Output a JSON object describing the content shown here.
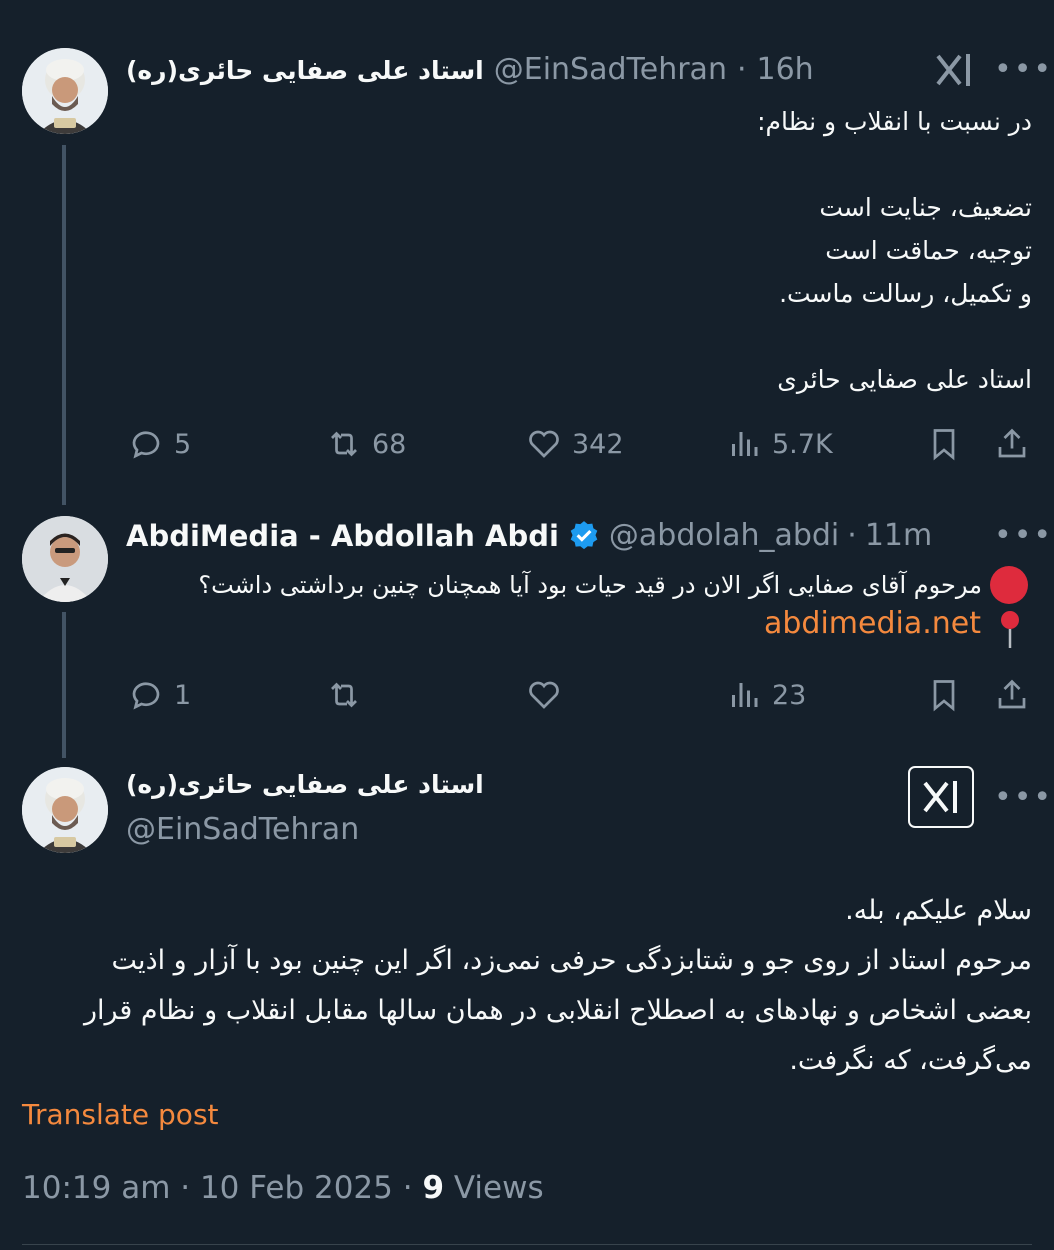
{
  "tweet1": {
    "display_name": "استاد علی صفایی حائری(ره)",
    "handle": "@EinSadTehran",
    "time": "16h",
    "lines": [
      "در نسبت با انقلاب و نظام:",
      "",
      "تضعیف، جنایت است",
      "توجیه، حماقت است",
      "و تکمیل، رسالت ماست.",
      "",
      "استاد علی صفایی حائری"
    ],
    "replies": "5",
    "reposts": "68",
    "likes": "342",
    "views": "5.7K"
  },
  "tweet2": {
    "display_name": "AbdiMedia - Abdollah Abdi",
    "verified": true,
    "handle": "@abdolah_abdi",
    "time": "11m",
    "line1": "مرحوم آقای صفایی اگر الان در قید حیات بود آیا همچنان چنین برداشتی داشت؟",
    "link": "abdimedia.net",
    "replies": "1",
    "reposts": "",
    "likes": "",
    "views": "23"
  },
  "tweet3": {
    "display_name": "استاد علی صفایی حائری(ره)",
    "handle": "@EinSadTehran",
    "lines": [
      "سلام علیکم، بله.",
      "مرحوم استاد از روی جو و شتابزدگی حرفی نمی‌زد، اگر این چنین بود با آزار و اذیت",
      "بعضی اشخاص و نهادهای به اصطلاح انقلابی در همان سالها مقابل انقلاب و نظام قرار",
      "می‌گرفت، که نگرفت."
    ],
    "translate": "Translate post",
    "timestamp": "10:19 am · 10 Feb 2025 · ",
    "views_count": "9",
    "views_label": " Views"
  },
  "separator": " · ",
  "more": "•••",
  "colors": {
    "background": "#15202b",
    "accent": "#f4893e",
    "muted": "#8b98a5",
    "verified": "#1d9bf0"
  },
  "icons": [
    "grok-icon",
    "more-icon",
    "reply-icon",
    "repost-icon",
    "like-icon",
    "views-icon",
    "bookmark-icon",
    "share-icon",
    "verified-badge-icon",
    "red-circle-emoji",
    "pushpin-emoji"
  ]
}
